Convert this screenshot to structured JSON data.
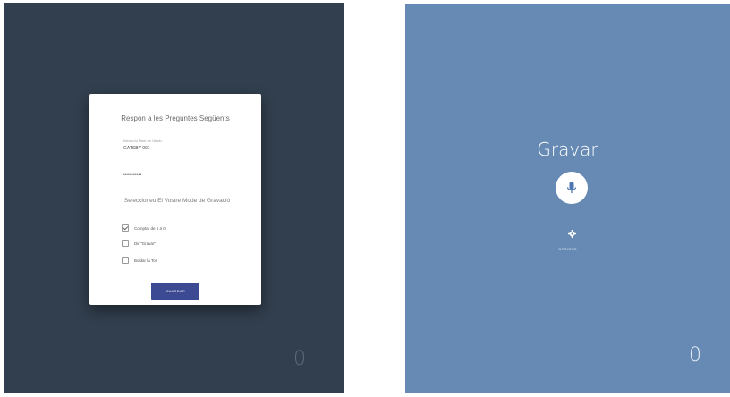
{
  "form": {
    "title": "Respon a les Preguntes Següents",
    "name_label": "Introduïu Nom de l'Arxiu",
    "name_value": "GATSBY 001",
    "password_value": "••••••••••",
    "prompt": "Seleccioneu El Vostre Mode de Gravació",
    "options": [
      {
        "label": "Comptar de 5 a 0",
        "checked": true
      },
      {
        "label": "Dir \"Gravar\"",
        "checked": false
      },
      {
        "label": "Boldar la Tos",
        "checked": false
      }
    ],
    "save_label": "GUARDAR"
  },
  "left_counter": "0",
  "record": {
    "title": "Gravar",
    "mic_icon": "microphone-icon",
    "settings_icon": "gear-icon",
    "settings_label": "OPCIONS",
    "counter": "0"
  },
  "colors": {
    "left_background": "#323f4e",
    "right_background": "#668ab4",
    "button": "#3b4a93",
    "mic_fill": "#4f76b3"
  }
}
